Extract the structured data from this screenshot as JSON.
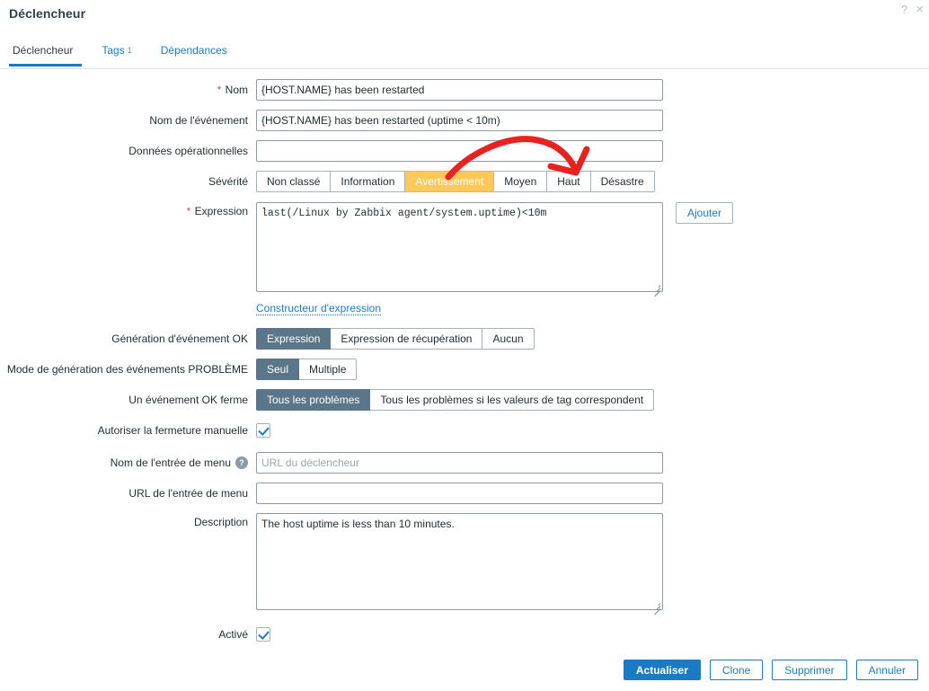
{
  "window": {
    "title": "Déclencheur",
    "help_icon": "?",
    "close_icon": "×"
  },
  "tabs": [
    {
      "label": "Déclencheur",
      "count": "",
      "active": true
    },
    {
      "label": "Tags",
      "count": "1",
      "active": false
    },
    {
      "label": "Dépendances",
      "count": "",
      "active": false
    }
  ],
  "form": {
    "name": {
      "label": "Nom",
      "required": true,
      "value": "{HOST.NAME} has been restarted",
      "placeholder": ""
    },
    "event_name": {
      "label": "Nom de l'événement",
      "required": false,
      "value": "{HOST.NAME} has been restarted (uptime < 10m)",
      "placeholder": ""
    },
    "operational_data": {
      "label": "Données opérationnelles",
      "required": false,
      "value": "",
      "placeholder": ""
    },
    "severity": {
      "label": "Sévérité",
      "options": [
        "Non classé",
        "Information",
        "Avertissement",
        "Moyen",
        "Haut",
        "Désastre"
      ],
      "selected": "Avertissement"
    },
    "expression": {
      "label": "Expression",
      "required": true,
      "value": "last(/Linux by Zabbix agent/system.uptime)<10m",
      "add_button": "Ajouter",
      "builder_link": "Constructeur d'expression"
    },
    "ok_event_generation": {
      "label": "Génération d'événement OK",
      "options": [
        "Expression",
        "Expression de récupération",
        "Aucun"
      ],
      "selected": "Expression"
    },
    "problem_event_mode": {
      "label": "Mode de génération des événements PROBLÈME",
      "options": [
        "Seul",
        "Multiple"
      ],
      "selected": "Seul"
    },
    "ok_event_closes": {
      "label": "Un événement OK ferme",
      "options": [
        "Tous les problèmes",
        "Tous les problèmes si les valeurs de tag correspondent"
      ],
      "selected": "Tous les problèmes"
    },
    "allow_manual_close": {
      "label": "Autoriser la fermeture manuelle",
      "checked": true
    },
    "menu_entry_name": {
      "label": "Nom de l'entrée de menu",
      "value": "",
      "placeholder": "URL du déclencheur",
      "help_icon": "?"
    },
    "menu_entry_url": {
      "label": "URL de l'entrée de menu",
      "value": "",
      "placeholder": ""
    },
    "description": {
      "label": "Description",
      "value": "The host uptime is less than 10 minutes.",
      "placeholder": ""
    },
    "enabled": {
      "label": "Activé",
      "checked": true
    }
  },
  "footer": {
    "update": "Actualiser",
    "clone": "Clone",
    "delete": "Supprimer",
    "cancel": "Annuler"
  },
  "annotation": {
    "type": "arrow",
    "color": "#e8231f",
    "description": "hand-drawn red arrow pointing at the Haut severity option"
  },
  "colors": {
    "accent": "#1a7ac4",
    "segment_selected": "#5b7689",
    "severity_warning": "#ffc859",
    "required_marker": "#d14c4c",
    "annotation_red": "#e8231f"
  }
}
